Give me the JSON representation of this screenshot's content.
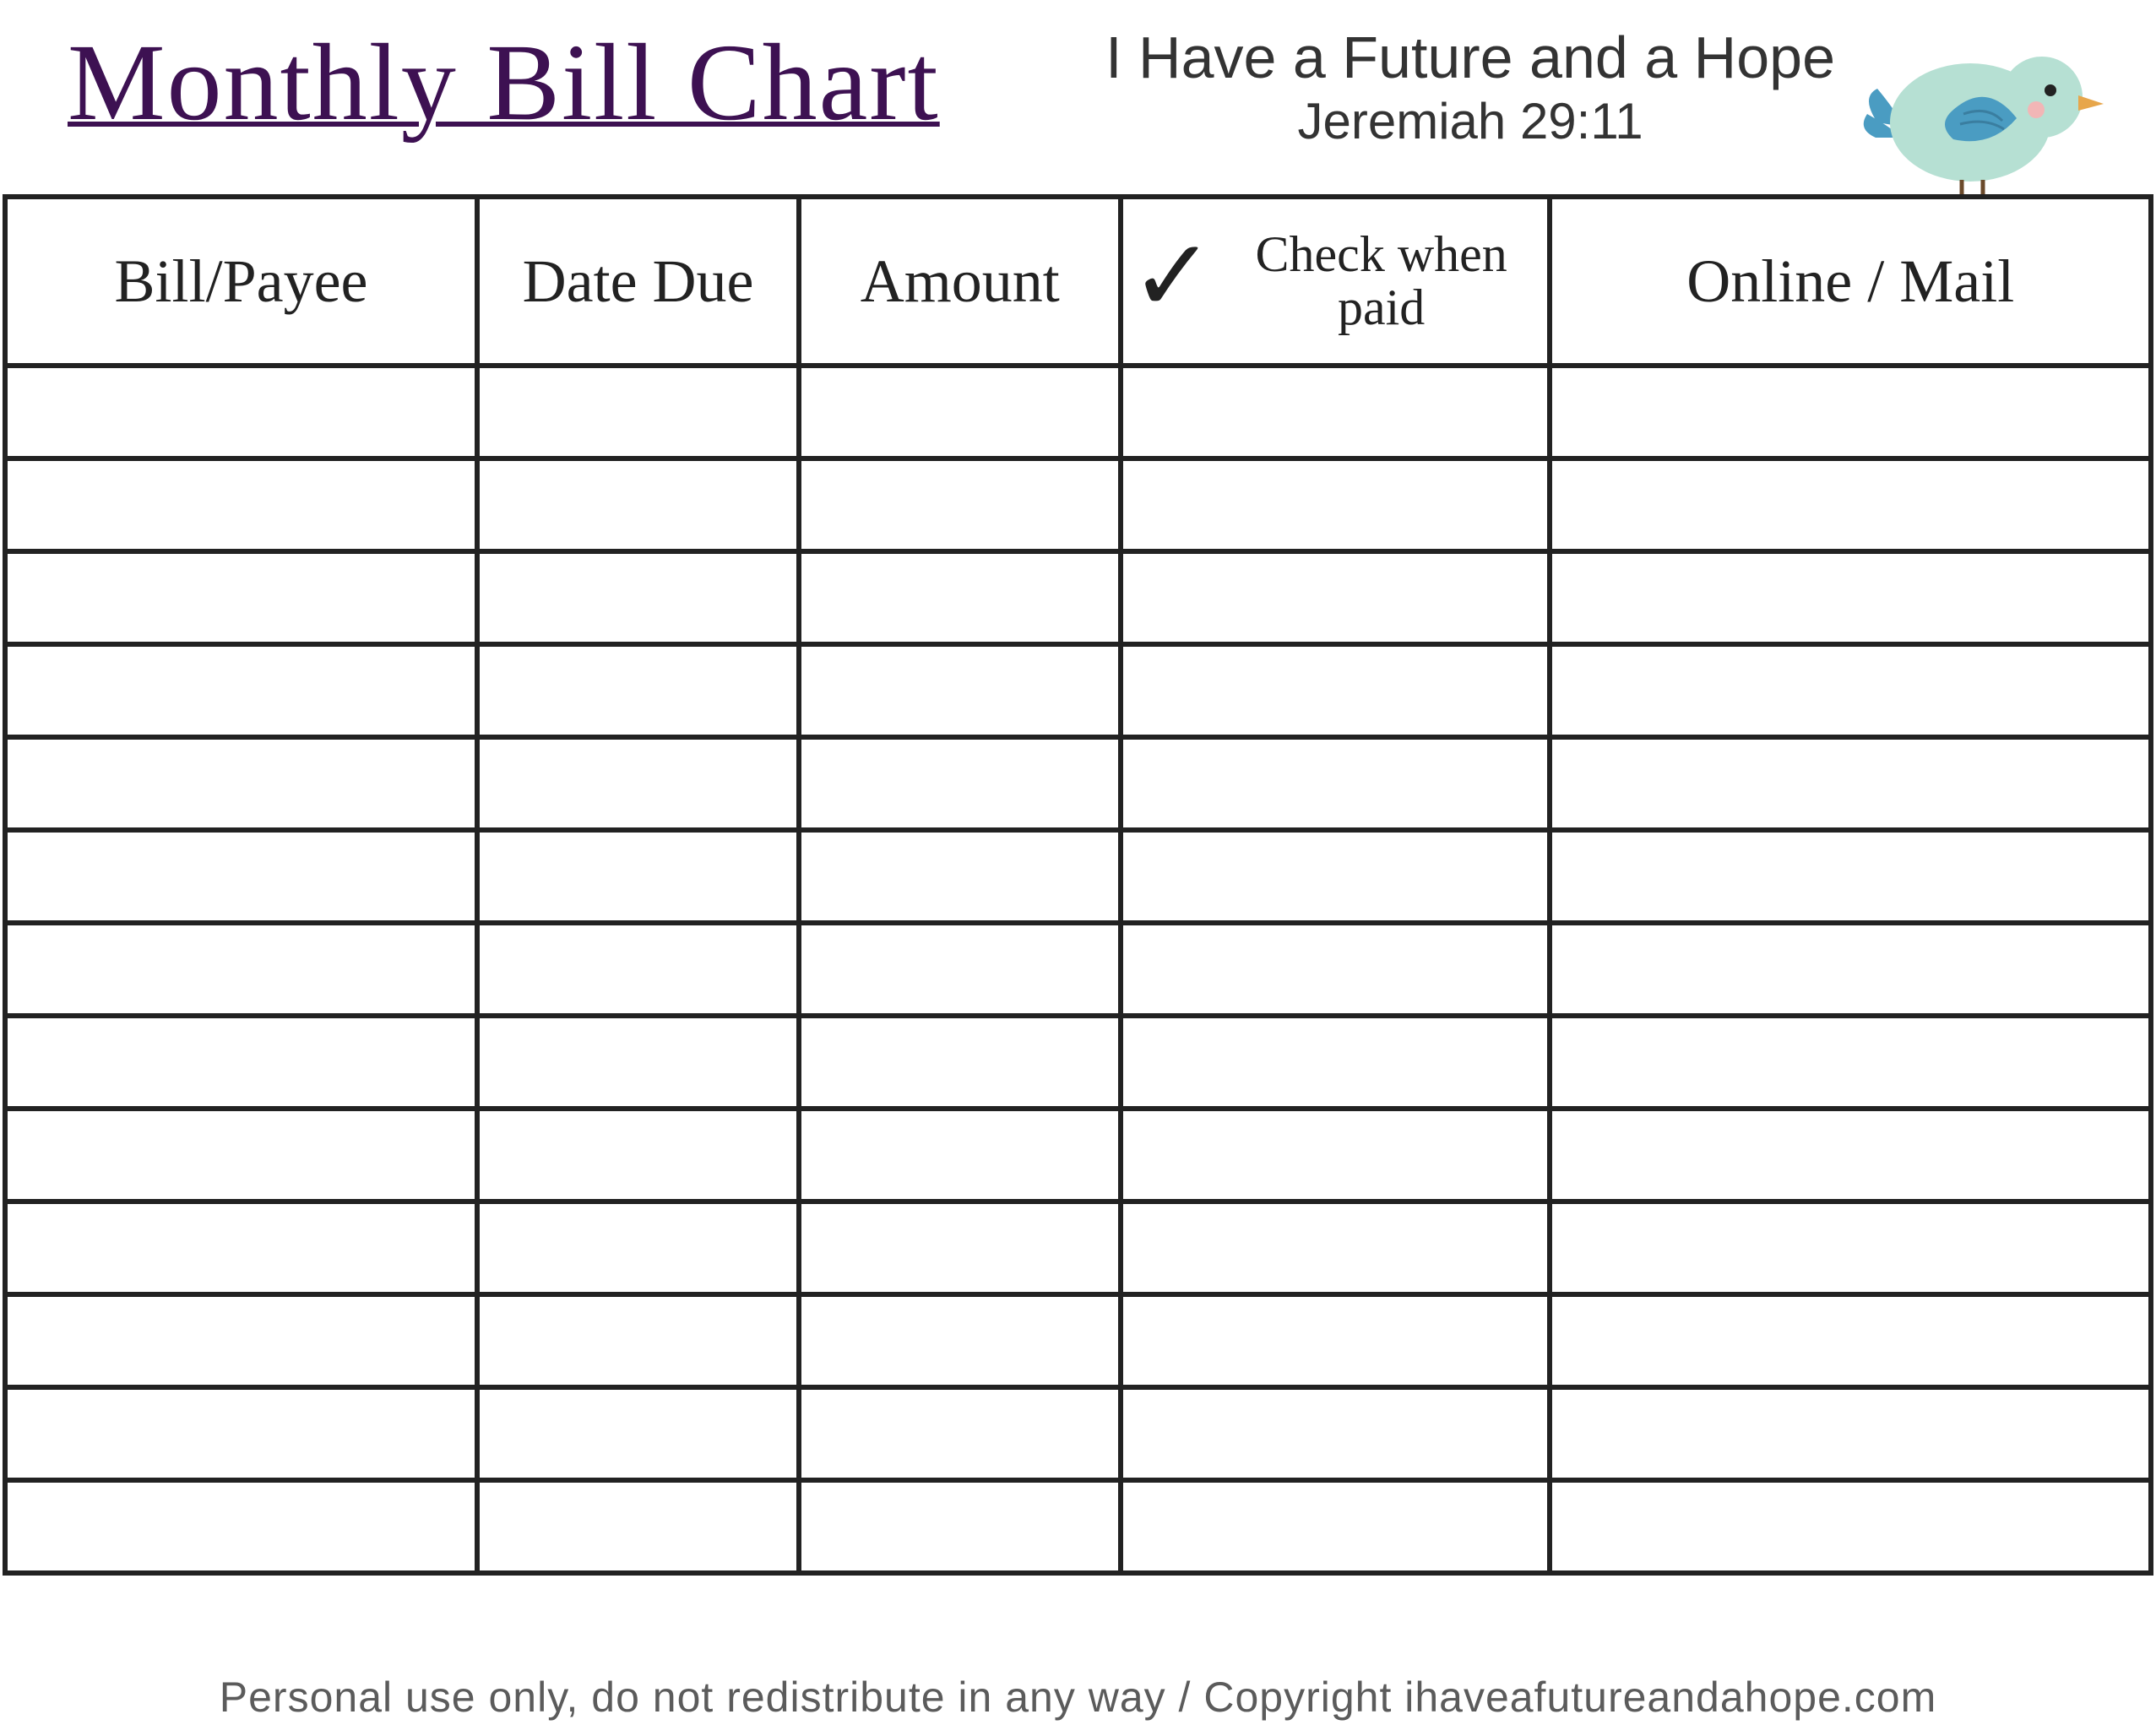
{
  "header": {
    "title": "Monthly Bill Chart",
    "quote_line1": "I Have a Future and a Hope",
    "quote_line2": "Jeremiah 29:11",
    "bird_icon": "bird-icon"
  },
  "table": {
    "columns": {
      "bill_payee": "Bill/Payee",
      "date_due": "Date Due",
      "amount": "Amount",
      "check_when_paid": "Check when paid",
      "online_mail": "Online / Mail"
    },
    "rows": [
      {
        "bill_payee": "",
        "date_due": "",
        "amount": "",
        "check_when_paid": "",
        "online_mail": ""
      },
      {
        "bill_payee": "",
        "date_due": "",
        "amount": "",
        "check_when_paid": "",
        "online_mail": ""
      },
      {
        "bill_payee": "",
        "date_due": "",
        "amount": "",
        "check_when_paid": "",
        "online_mail": ""
      },
      {
        "bill_payee": "",
        "date_due": "",
        "amount": "",
        "check_when_paid": "",
        "online_mail": ""
      },
      {
        "bill_payee": "",
        "date_due": "",
        "amount": "",
        "check_when_paid": "",
        "online_mail": ""
      },
      {
        "bill_payee": "",
        "date_due": "",
        "amount": "",
        "check_when_paid": "",
        "online_mail": ""
      },
      {
        "bill_payee": "",
        "date_due": "",
        "amount": "",
        "check_when_paid": "",
        "online_mail": ""
      },
      {
        "bill_payee": "",
        "date_due": "",
        "amount": "",
        "check_when_paid": "",
        "online_mail": ""
      },
      {
        "bill_payee": "",
        "date_due": "",
        "amount": "",
        "check_when_paid": "",
        "online_mail": ""
      },
      {
        "bill_payee": "",
        "date_due": "",
        "amount": "",
        "check_when_paid": "",
        "online_mail": ""
      },
      {
        "bill_payee": "",
        "date_due": "",
        "amount": "",
        "check_when_paid": "",
        "online_mail": ""
      },
      {
        "bill_payee": "",
        "date_due": "",
        "amount": "",
        "check_when_paid": "",
        "online_mail": ""
      },
      {
        "bill_payee": "",
        "date_due": "",
        "amount": "",
        "check_when_paid": "",
        "online_mail": ""
      }
    ]
  },
  "footer": {
    "text": "Personal use only, do not redistribute in any way / Copyright ihaveafutureandahope.com"
  },
  "colors": {
    "title": "#3d1152",
    "border": "#222222",
    "bird_body": "#b6e0d3",
    "bird_wing": "#4a9cc2",
    "bird_beak": "#e7a64b"
  }
}
